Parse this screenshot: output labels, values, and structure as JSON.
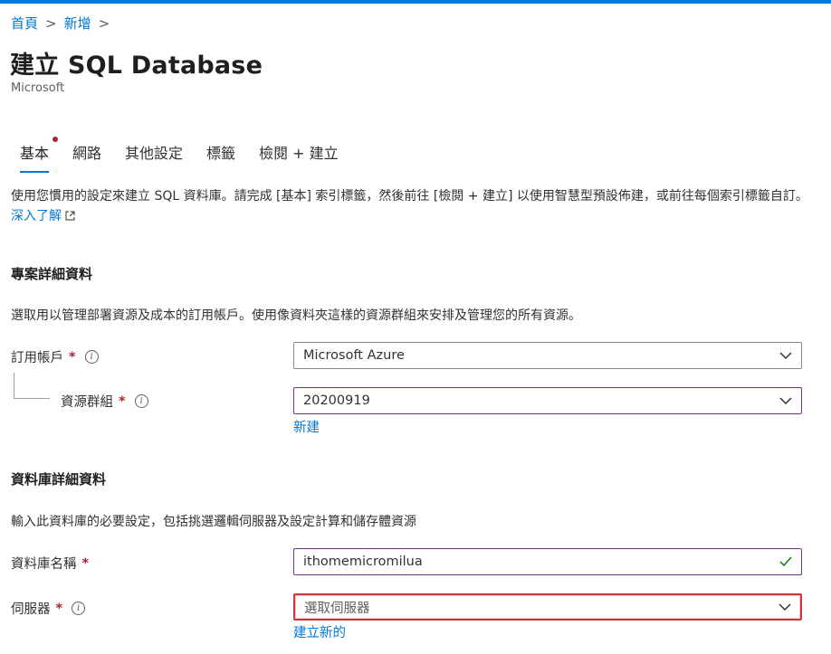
{
  "breadcrumb": {
    "items": [
      "首頁",
      "新增"
    ]
  },
  "page": {
    "title": "建立 SQL Database",
    "publisher": "Microsoft"
  },
  "tabs": [
    {
      "label": "基本",
      "active": true,
      "has_error": true
    },
    {
      "label": "網路"
    },
    {
      "label": "其他設定"
    },
    {
      "label": "標籤"
    },
    {
      "label": "檢閱 + 建立"
    }
  ],
  "intro": {
    "text": "使用您慣用的設定來建立 SQL 資料庫。請完成 [基本] 索引標籤，然後前往 [檢閱 + 建立] 以使用智慧型預設佈建，或前往每個索引標籤自訂。",
    "link": "深入了解"
  },
  "project": {
    "title": "專案詳細資料",
    "description": "選取用以管理部署資源及成本的訂用帳戶。使用像資料夾這樣的資源群組來安排及管理您的所有資源。",
    "subscription": {
      "label": "訂用帳戶",
      "required": "*",
      "value": "Microsoft Azure"
    },
    "resource_group": {
      "label": "資源群組",
      "required": "*",
      "value": "20200919",
      "create_link": "新建"
    }
  },
  "database": {
    "title": "資料庫詳細資料",
    "description": "輸入此資料庫的必要設定，包括挑選邏輯伺服器及設定計算和儲存體資源",
    "name": {
      "label": "資料庫名稱",
      "required": "*",
      "value": "ithomemicromilua"
    },
    "server": {
      "label": "伺服器",
      "required": "*",
      "placeholder": "選取伺服器",
      "create_link": "建立新的"
    }
  },
  "colors": {
    "accent": "#0078d4",
    "error": "#d13438",
    "required": "#a4262c",
    "valid": "#107c10",
    "focus": "#7a2f8e"
  },
  "icons": {
    "info": "info-icon",
    "chevron": "chevron-down-icon",
    "check": "checkmark-icon",
    "external": "external-link-icon"
  }
}
